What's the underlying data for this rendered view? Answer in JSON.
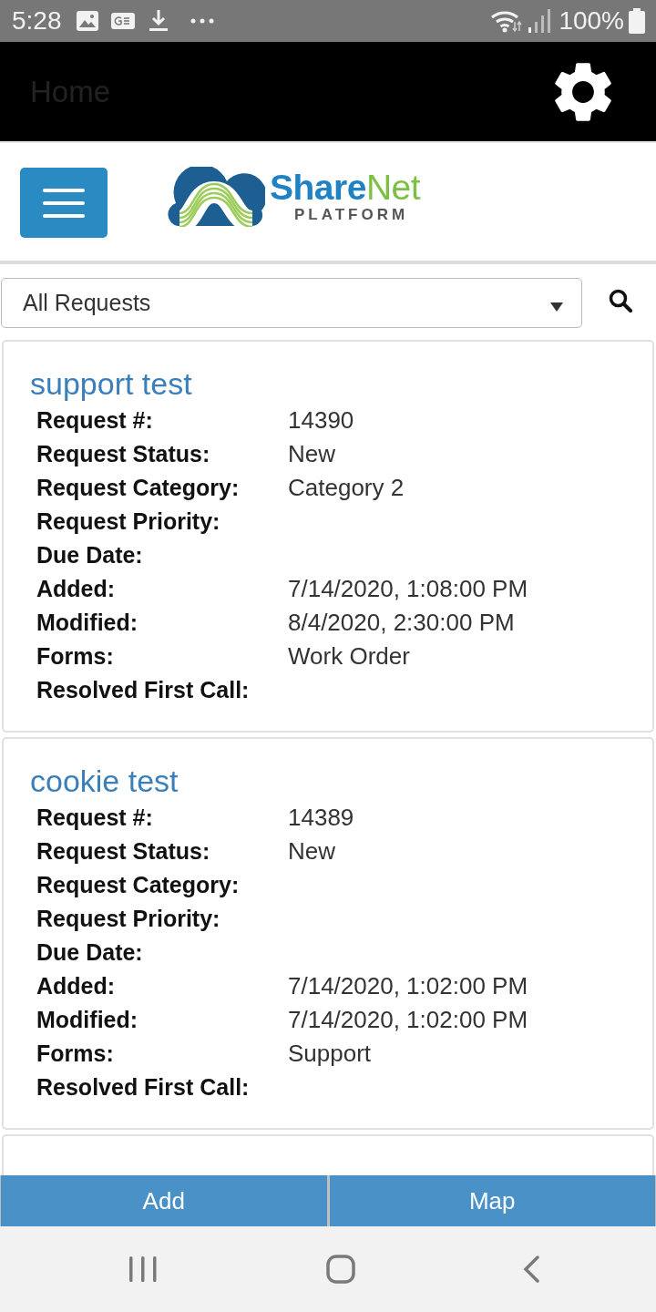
{
  "status_bar": {
    "time": "5:28",
    "battery": "100%"
  },
  "app_bar": {
    "title": "Home"
  },
  "header": {
    "logo": {
      "name_first": "Share",
      "name_second": "Net",
      "tagline": "PLATFORM"
    }
  },
  "filter": {
    "value": "All Requests"
  },
  "requests": [
    {
      "title": "support test",
      "fields": [
        {
          "label": "Request #:",
          "value": "14390"
        },
        {
          "label": "Request Status:",
          "value": "New"
        },
        {
          "label": "Request Category:",
          "value": "Category 2"
        },
        {
          "label": "Request Priority:"
        },
        {
          "label": "Due Date:"
        },
        {
          "label": "Added:",
          "value": "7/14/2020, 1:08:00 PM"
        },
        {
          "label": "Modified:",
          "value": "8/4/2020, 2:30:00 PM"
        },
        {
          "label": "Forms:",
          "value": "Work Order"
        },
        {
          "label": "Resolved First Call:"
        }
      ]
    },
    {
      "title": "cookie test",
      "fields": [
        {
          "label": "Request #:",
          "value": "14389"
        },
        {
          "label": "Request Status:",
          "value": "New"
        },
        {
          "label": "Request Category:"
        },
        {
          "label": "Request Priority:"
        },
        {
          "label": "Due Date:"
        },
        {
          "label": "Added:",
          "value": "7/14/2020, 1:02:00 PM"
        },
        {
          "label": "Modified:",
          "value": "7/14/2020, 1:02:00 PM"
        },
        {
          "label": "Forms:",
          "value": "Support"
        },
        {
          "label": "Resolved First Call:"
        }
      ]
    }
  ],
  "bottom_bar": {
    "buttons": [
      "Add",
      "Map"
    ]
  }
}
